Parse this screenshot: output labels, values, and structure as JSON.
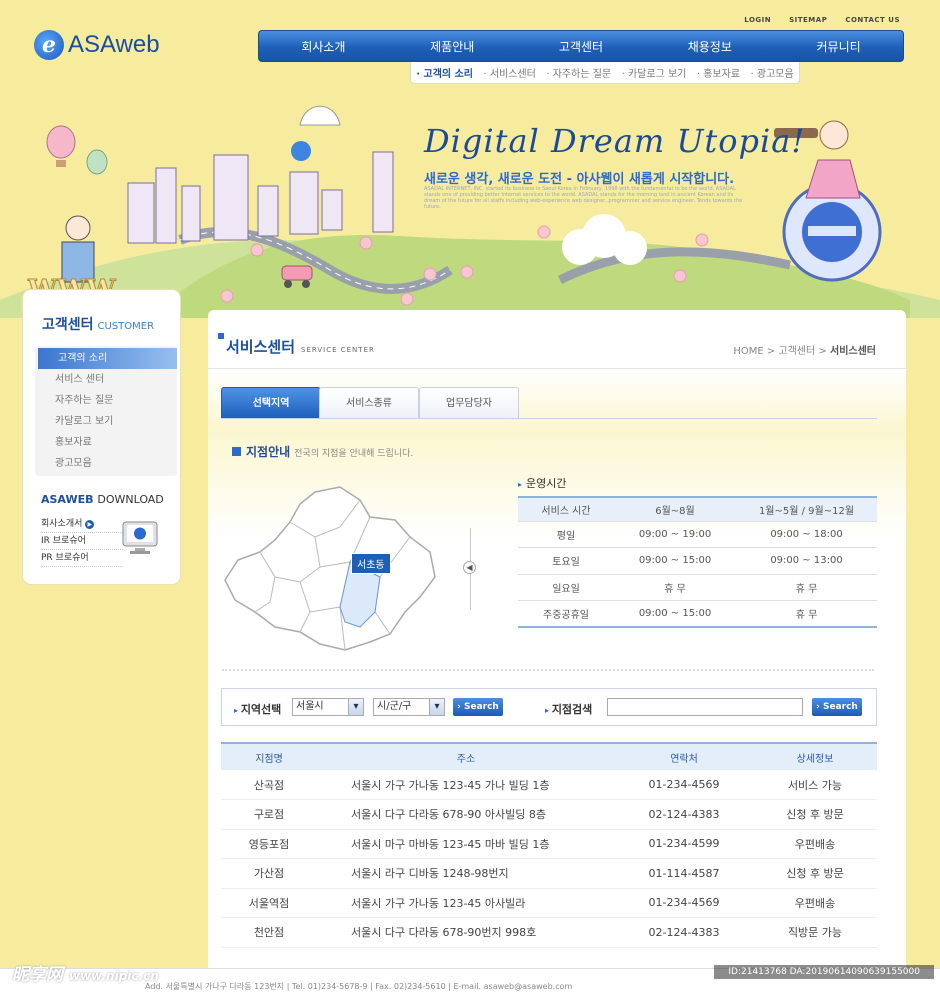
{
  "util_links": [
    "LOGIN",
    "SITEMAP",
    "CONTACT US"
  ],
  "logo": {
    "mark": "e",
    "text": "ASAweb"
  },
  "gnb": [
    "회사소개",
    "제품안내",
    "고객센터",
    "채용정보",
    "커뮤니티"
  ],
  "lnb": [
    "· 고객의 소리",
    "· 서비스센터",
    "· 자주하는 질문",
    "· 카달로그 보기",
    "· 홍보자료",
    "· 광고모음"
  ],
  "hero": {
    "slogan": "Digital Dream Utopia!",
    "sub": "새로운 생각, 새로운 도전 - 아사웹이 새롭게 시작합니다.",
    "fine": "ASADAL INTERNET, INC. started its business in Seoul Korea in February, 1998 with the fundamental to be the world. ASADAL stands one of providing better Internet services to the world. ASADAL stands for the morning land in ancient Korean and its dream of the future for all staffs including web-experience web designer, programmer and service engineer. Tends towards the future.",
    "www": "WWW"
  },
  "side": {
    "title": "고객센터",
    "title_en": "CUSTOMER",
    "menu": [
      "고객의 소리",
      "서비스 센터",
      "자주하는 질문",
      "카달로그 보기",
      "홍보자료",
      "광고모음"
    ],
    "download_title_a": "ASAWEB",
    "download_title_b": "DOWNLOAD",
    "downloads": [
      "회사소개서",
      "IR 브로슈어",
      "PR 브로슈어"
    ]
  },
  "main": {
    "title": "서비스센터",
    "title_en": "SERVICE CENTER",
    "crumb_home": "HOME",
    "crumb_1": "고객센터",
    "crumb_2": "서비스센터",
    "tabs": [
      "선택지역",
      "서비스종류",
      "업무담당자"
    ],
    "branch_title": "지점안내",
    "branch_desc": "전국의 지점을 안내해 드립니다.",
    "map_label": "서초동",
    "hours_title": "운영시간",
    "hours": [
      [
        "서비스 시간",
        "6월~8월",
        "1월~5월 / 9월~12월"
      ],
      [
        "평일",
        "09:00 ~ 19:00",
        "09:00 ~ 18:00"
      ],
      [
        "토요일",
        "09:00 ~ 15:00",
        "09:00 ~ 13:00"
      ],
      [
        "일요일",
        "휴 무",
        "휴 무"
      ],
      [
        "주중공휴일",
        "09:00 ~ 15:00",
        "휴 무"
      ]
    ],
    "search": {
      "region_label": "지역선택",
      "city": "서울시",
      "district": "시/군/구",
      "button": "Search",
      "branch_label": "지점검색",
      "button2": "Search"
    },
    "columns": [
      "지점명",
      "주소",
      "연락처",
      "상세정보"
    ],
    "rows": [
      [
        "산곡점",
        "서울시 가구 가나동 123-45  가나 빌딩 1층",
        "01-234-4569",
        "서비스 가능"
      ],
      [
        "구로점",
        "서울시 다구 다라동 678-90 아사빌딩 8층",
        "02-124-4383",
        "신청 후 방문"
      ],
      [
        "영등포점",
        "서울시 마구 마바동 123-45  마바 빌딩 1층",
        "01-234-4599",
        "우편배송"
      ],
      [
        "가산점",
        "서울시 라구 디바동 1248-98번지",
        "01-114-4587",
        "신청 후 방문"
      ],
      [
        "서울역점",
        "서울시 가구 가나동 123-45  아사빌라",
        "01-234-4569",
        "우편배송"
      ],
      [
        "천안점",
        "서울시 다구 다라동 678-90번지 998호",
        "02-124-4383",
        "직방문 가능"
      ]
    ]
  },
  "footer": {
    "addr": "Add. 서울특별시 가나구 다라동 123번지  |  Tel. 01)234-5678-9  |  Fax. 02)234-5610  |  E-mail. asaweb@asaweb.com"
  },
  "watermark": {
    "brand": "昵享网",
    "url": "www.nipic.cn",
    "id": "ID:21413768 DA:20190614090639155000"
  },
  "colors": {
    "accent": "#1d5fb8",
    "bg": "#f7ec9e"
  }
}
